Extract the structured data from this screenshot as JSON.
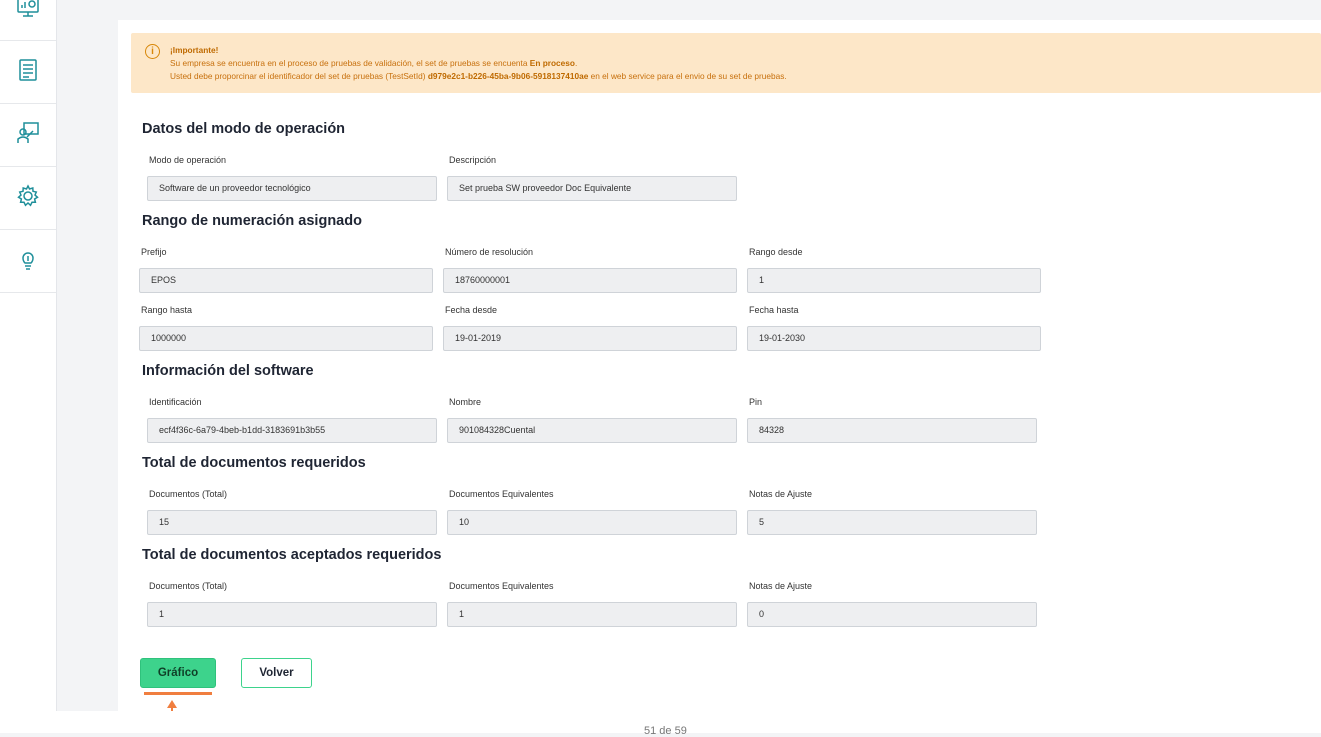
{
  "sidebar": {
    "items": [
      {
        "icon": "monitor-chart-icon"
      },
      {
        "icon": "document-list-icon"
      },
      {
        "icon": "user-presentation-icon"
      },
      {
        "icon": "gear-icon"
      },
      {
        "icon": "lightbulb-icon"
      }
    ]
  },
  "alert": {
    "title": "¡Importante!",
    "line1_prefix": "Su empresa se encuentra en el proceso de pruebas de validación, el set de pruebas se encuenta ",
    "line1_status": "En proceso",
    "line1_suffix": ".",
    "line2_prefix": "Usted debe proporcinar el identificador del set de pruebas (TestSetId) ",
    "line2_id": "d979e2c1-b226-45ba-9b06-5918137410ae",
    "line2_suffix": " en el web service para el envio de su set de pruebas."
  },
  "operation": {
    "title": "Datos del modo de operación",
    "mode_label": "Modo de operación",
    "mode_value": "Software de un proveedor tecnológico",
    "desc_label": "Descripción",
    "desc_value": "Set prueba SW proveedor Doc Equivalente"
  },
  "range": {
    "title": "Rango de numeración asignado",
    "prefix_label": "Prefijo",
    "prefix_value": "EPOS",
    "resolution_label": "Número de resolución",
    "resolution_value": "18760000001",
    "from_label": "Rango desde",
    "from_value": "1",
    "to_label": "Rango hasta",
    "to_value": "1000000",
    "date_from_label": "Fecha desde",
    "date_from_value": "19-01-2019",
    "date_to_label": "Fecha hasta",
    "date_to_value": "19-01-2030"
  },
  "software": {
    "title": "Información del software",
    "id_label": "Identificación",
    "id_value": "ecf4f36c-6a79-4beb-b1dd-3183691b3b55",
    "name_label": "Nombre",
    "name_value": "901084328Cuental",
    "pin_label": "Pin",
    "pin_value": "84328"
  },
  "required": {
    "title": "Total de documentos requeridos",
    "total_label": "Documentos (Total)",
    "total_value": "15",
    "equiv_label": "Documentos Equivalentes",
    "equiv_value": "10",
    "notes_label": "Notas de Ajuste",
    "notes_value": "5"
  },
  "accepted": {
    "title": "Total de documentos aceptados requeridos",
    "total_label": "Documentos (Total)",
    "total_value": "1",
    "equiv_label": "Documentos Equivalentes",
    "equiv_value": "1",
    "notes_label": "Notas de Ajuste",
    "notes_value": "0"
  },
  "actions": {
    "chart_label": "Gráfico",
    "back_label": "Volver"
  },
  "footer": {
    "page_text": "51 de 59"
  },
  "colors": {
    "accent_green": "#3dd38c",
    "alert_bg": "#fde7c8",
    "alert_text": "#c7700d",
    "icon_teal": "#1f8f9a",
    "annotation_orange": "#f07e3f"
  }
}
